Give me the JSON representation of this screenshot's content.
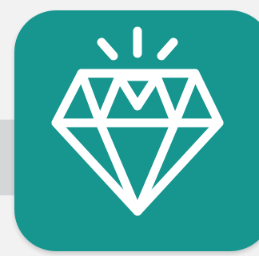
{
  "app_icon": {
    "icon": "diamond-icon",
    "sparkle_icon": "sparkle-icon",
    "colors": {
      "tile": "#16968f",
      "tile_shade": "#138a83",
      "glyph": "#ffffff",
      "backdrop": "#f2f2f3",
      "backdrop_band": "#d4d6d8"
    }
  }
}
